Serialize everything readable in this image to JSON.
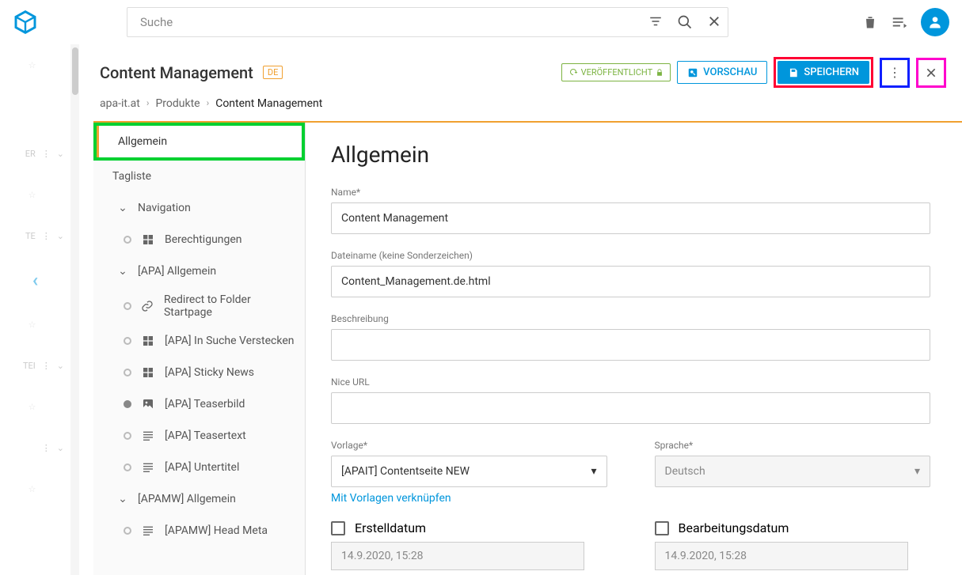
{
  "search": {
    "placeholder": "Suche"
  },
  "header": {
    "title": "Content Management",
    "lang": "DE",
    "status": "VERÖFFENTLICHT",
    "preview": "VORSCHAU",
    "save": "SPEICHERN"
  },
  "breadcrumb": [
    "apa-it.at",
    "Produkte",
    "Content Management"
  ],
  "sidebar": {
    "items": [
      {
        "label": "Allgemein",
        "active": true,
        "level": 1
      },
      {
        "label": "Tagliste",
        "level": 1
      },
      {
        "label": "Navigation",
        "level": 2,
        "expandable": true
      },
      {
        "label": "Berechtigungen",
        "level": 3,
        "icon": "grid"
      },
      {
        "label": "[APA] Allgemein",
        "level": 2,
        "expandable": true
      },
      {
        "label": "Redirect to Folder Startpage",
        "level": 3,
        "icon": "link"
      },
      {
        "label": "[APA] In Suche Verstecken",
        "level": 3,
        "icon": "grid"
      },
      {
        "label": "[APA] Sticky News",
        "level": 3,
        "icon": "grid"
      },
      {
        "label": "[APA] Teaserbild",
        "level": 3,
        "icon": "image",
        "fill": true
      },
      {
        "label": "[APA] Teasertext",
        "level": 3,
        "icon": "lines"
      },
      {
        "label": "[APA] Untertitel",
        "level": 3,
        "icon": "lines"
      },
      {
        "label": "[APAMW] Allgemein",
        "level": 2,
        "expandable": true
      },
      {
        "label": "[APAMW] Head Meta",
        "level": 3,
        "icon": "lines"
      }
    ]
  },
  "form": {
    "heading": "Allgemein",
    "name_label": "Name*",
    "name_value": "Content Management",
    "filename_label": "Dateiname (keine Sonderzeichen)",
    "filename_value": "Content_Management.de.html",
    "desc_label": "Beschreibung",
    "desc_value": "",
    "niceurl_label": "Nice URL",
    "niceurl_value": "",
    "template_label": "Vorlage*",
    "template_value": "[APAIT] Contentseite NEW",
    "template_link": "Mit Vorlagen verknüpfen",
    "lang_label": "Sprache*",
    "lang_value": "Deutsch",
    "created_label": "Erstelldatum",
    "created_value": "14.9.2020, 15:28",
    "edited_label": "Bearbeitungsdatum",
    "edited_value": "14.9.2020, 15:28"
  },
  "strip": [
    "ER",
    "",
    "TE",
    "",
    "",
    "TEI",
    ""
  ]
}
